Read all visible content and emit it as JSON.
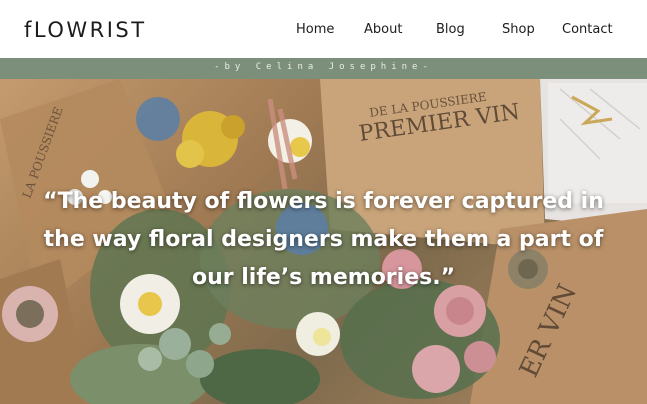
{
  "brand": {
    "logo": "fLOWRIST"
  },
  "nav": {
    "items": [
      "Home",
      "About",
      "Blog",
      "Shop",
      "Contact"
    ]
  },
  "tagline": "-by Celina Josephine-",
  "hero": {
    "quote": "“The beauty of flowers is forever captured in the way floral designers make them a part of our life’s memories.”",
    "newspaper_text_1": "PREMIER VIN",
    "newspaper_text_2": "DE LA POUSSIERE",
    "newspaper_text_3": "LA POUSSIERE",
    "newspaper_text_4": "ER VIN"
  },
  "colors": {
    "tagline_bar": "#7c8f7a",
    "header_bg": "#ffffff",
    "text_dark": "#1c1c1c"
  }
}
